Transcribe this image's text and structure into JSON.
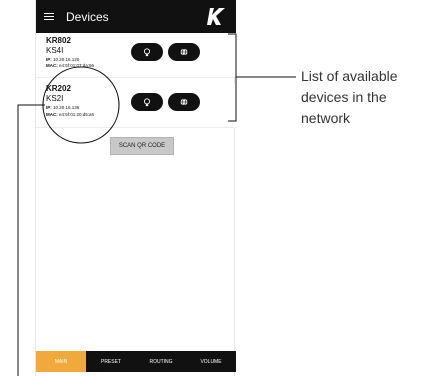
{
  "header": {
    "title": "Devices"
  },
  "devices": [
    {
      "model": "KR802",
      "name": "KS4I",
      "ip_label": "IP:",
      "ip": "10.20.16.120",
      "mac_label": "MAC:",
      "mac": "e4:5f:01:07:da:66"
    },
    {
      "model": "KR202",
      "name": "KS2I",
      "ip_label": "IP:",
      "ip": "10.20.16.136",
      "mac_label": "MAC:",
      "mac": "e4:5f:01:20:d5:a5"
    }
  ],
  "scan_button": "SCAN QR CODE",
  "nav": [
    {
      "label": "MAIN",
      "active": true
    },
    {
      "label": "PRESET",
      "active": false
    },
    {
      "label": "ROUTING",
      "active": false
    },
    {
      "label": "VOLUME",
      "active": false
    }
  ],
  "annotation": {
    "line1": "List of available",
    "line2": "devices in the",
    "line3": "network"
  },
  "colors": {
    "appbar": "#111111",
    "active_tab": "#f2a93b",
    "button_gray": "#c8c8c8"
  },
  "icons": [
    "menu-icon",
    "brand-logo",
    "bulb-icon",
    "globe-icon"
  ]
}
